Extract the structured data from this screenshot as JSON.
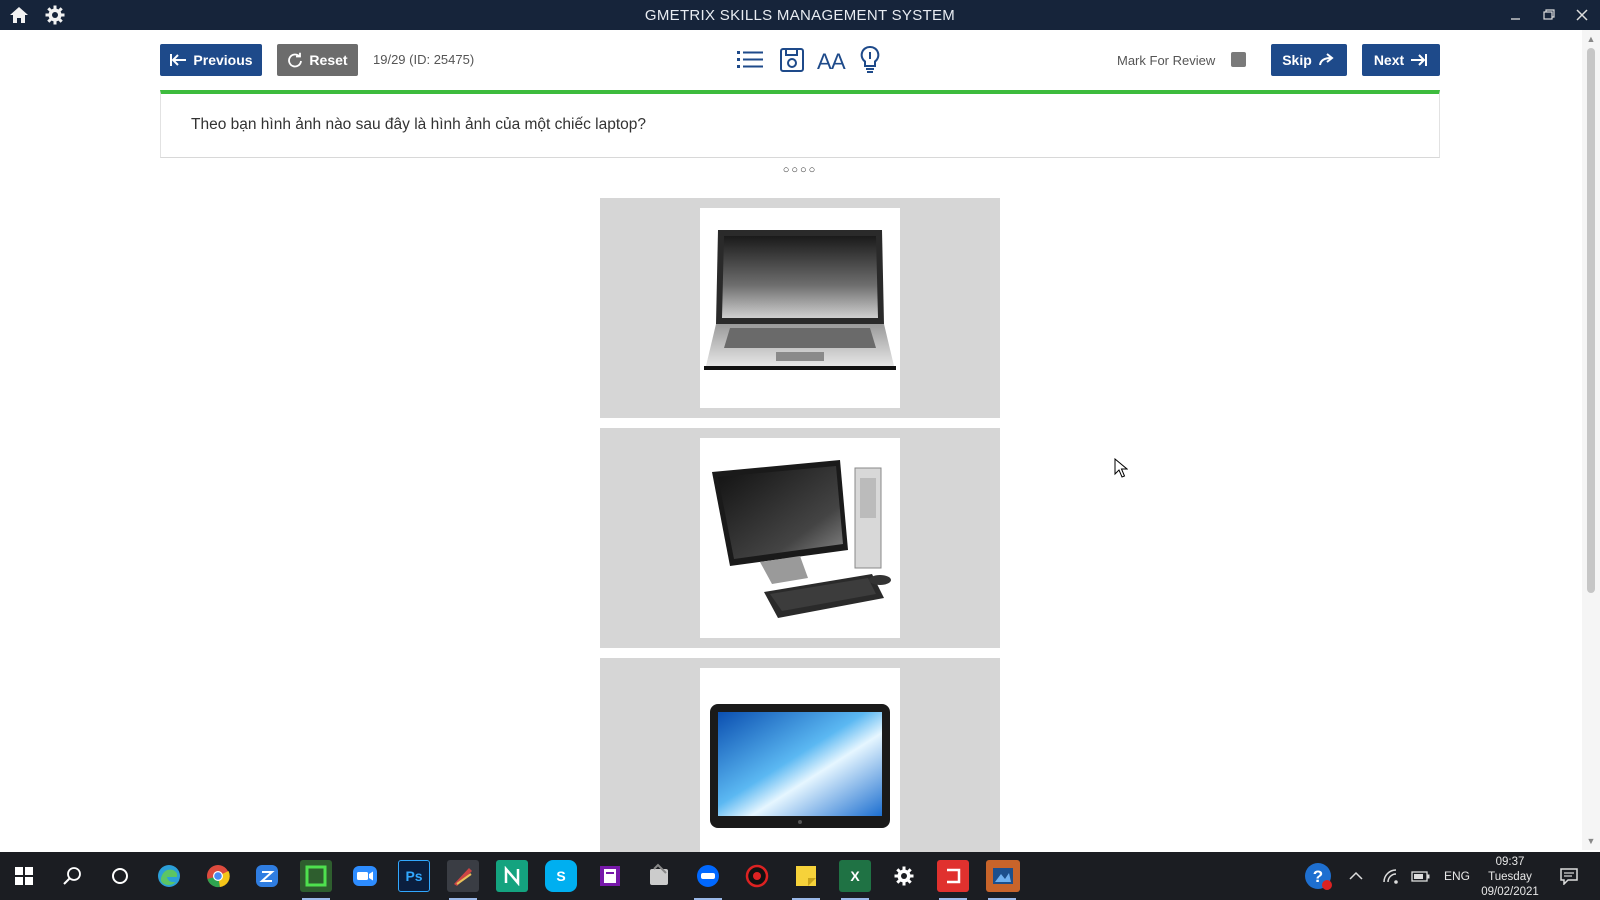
{
  "window": {
    "title": "GMETRIX SKILLS MANAGEMENT SYSTEM"
  },
  "titlebar": {
    "home_icon": "home-icon",
    "settings_icon": "gear-icon"
  },
  "toolbar": {
    "previous_label": "Previous",
    "reset_label": "Reset",
    "progress_text": "19/29 (ID: 25475)",
    "tools": [
      "list-icon",
      "save-icon",
      "font-size-icon",
      "hint-lightbulb-icon"
    ],
    "mark_for_review_label": "Mark For Review",
    "skip_label": "Skip",
    "next_label": "Next"
  },
  "question": {
    "text": "Theo bạn hình ảnh nào sau đây là hình ảnh của một chiếc laptop?",
    "dots": "○○○○"
  },
  "options": [
    {
      "image": "laptop-image"
    },
    {
      "image": "all-in-one-desktop-image"
    },
    {
      "image": "tablet-image"
    }
  ],
  "colors": {
    "titlebar": "#16243a",
    "button_blue": "#1e4a8a",
    "button_gray": "#6c6c6c",
    "progress_bar": "#3dbb3d",
    "option_bg": "#d6d6d6",
    "taskbar": "#1b1d22"
  },
  "taskbar": {
    "apps": [
      "windows-start-icon",
      "search-icon",
      "cortana-icon",
      "edge-icon",
      "chrome-icon",
      "zalo-icon",
      "camtasia-icon",
      "zoom-icon",
      "photoshop-icon",
      "app-icon",
      "notion-icon",
      "skype-icon",
      "onenote-icon",
      "app-icon",
      "zalo-icon",
      "record-icon",
      "sticky-notes-icon",
      "excel-icon",
      "settings-icon",
      "snagit-icon",
      "app-icon"
    ],
    "photoshop_label": "Ps",
    "skype_label": "S",
    "excel_label": "X",
    "language": "ENG",
    "time": "09:37",
    "day": "Tuesday",
    "date": "09/02/2021"
  }
}
